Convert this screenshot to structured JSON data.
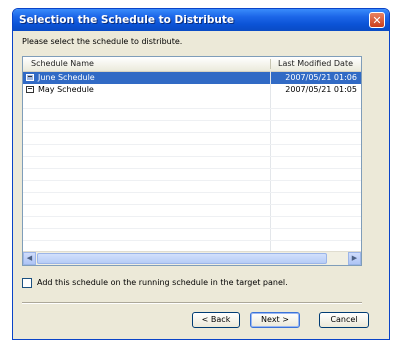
{
  "dialog": {
    "title": "Selection the Schedule to Distribute",
    "close_glyph": "✕",
    "instruction": "Please select the schedule to distribute."
  },
  "list": {
    "columns": [
      "Schedule Name",
      "Last Modified Date"
    ],
    "rows": [
      {
        "name": "June Schedule",
        "date": "2007/05/21 01:06",
        "selected": true,
        "icon": "schedule-icon"
      },
      {
        "name": "May Schedule",
        "date": "2007/05/21 01:05",
        "selected": false,
        "icon": "schedule-icon"
      }
    ],
    "scroll_left": "◀",
    "scroll_right": "▶"
  },
  "option": {
    "checked": false,
    "label": "Add this schedule on the running schedule in the target panel."
  },
  "buttons": {
    "back": "< Back",
    "next": "Next >",
    "cancel": "Cancel"
  },
  "colors": {
    "titlebar": "#0b53d6",
    "selection": "#316ac5",
    "dialog_bg": "#ece9d8"
  }
}
